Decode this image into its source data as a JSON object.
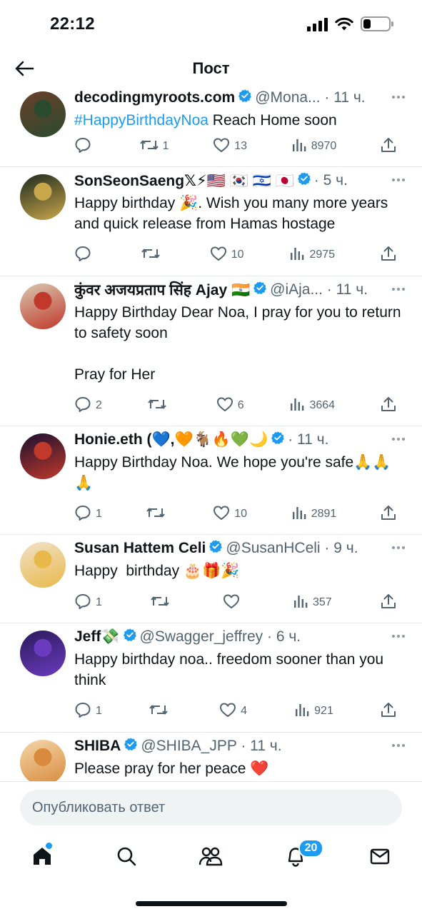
{
  "status_bar": {
    "time": "22:12",
    "battery_level": 0.3
  },
  "header": {
    "title": "Пост"
  },
  "tweets": [
    {
      "name": "decodingmyroots.com",
      "meta": "@Mona... · 11 ч.",
      "hashtag": "#HappyBirthdayNoa",
      "text": " Reach Home soon",
      "reply_count": "",
      "retweet_count": "1",
      "like_count": "13",
      "view_count": "8970",
      "avatar_colors": [
        "#6b3f2a",
        "#2a4b2e"
      ]
    },
    {
      "name": "SonSeonSaeng𝕏⚡🇺🇸 🇰🇷 🇮🇱 🇯🇵",
      "meta": "· 5 ч.",
      "text": "Happy birthday 🎉. Wish you many more years and quick release from Hamas hostage",
      "reply_count": "",
      "retweet_count": "",
      "like_count": "10",
      "view_count": "2975",
      "avatar_colors": [
        "#1d2a1f",
        "#c8a64a"
      ]
    },
    {
      "name": "कुंवर अजयप्रताप सिंह Ajay 🇮🇳",
      "meta": "@iAja... · 11 ч.",
      "text": "Happy Birthday Dear Noa, I pray for you to return to safety soon\n\nPray for Her",
      "reply_count": "2",
      "retweet_count": "",
      "like_count": "6",
      "view_count": "3664",
      "avatar_colors": [
        "#d9c8b0",
        "#c0392b"
      ]
    },
    {
      "name": "Honie.eth (💙,🧡🐐🔥💚🌙",
      "meta": "· 11 ч.",
      "text": "Happy Birthday Noa. We hope you're safe🙏🙏🙏",
      "reply_count": "1",
      "retweet_count": "",
      "like_count": "10",
      "view_count": "2891",
      "avatar_colors": [
        "#1a1030",
        "#c0392b"
      ]
    },
    {
      "name": "Susan Hattem Celi",
      "meta": "@SusanHCeli · 9 ч.",
      "text": "Happy  birthday 🎂🎁🎉",
      "reply_count": "1",
      "retweet_count": "",
      "like_count": "",
      "view_count": "357",
      "avatar_colors": [
        "#f1e2c8",
        "#e8b84a"
      ]
    },
    {
      "name": "Jeff💸",
      "meta": "@Swagger_jeffrey · 6 ч.",
      "text": "Happy birthday noa.. freedom sooner than you think",
      "reply_count": "1",
      "retweet_count": "",
      "like_count": "4",
      "view_count": "921",
      "avatar_colors": [
        "#2b1a5a",
        "#6a3bbf"
      ]
    },
    {
      "name": "SHIBA",
      "meta": "@SHIBA_JPP · 11 ч.",
      "text": "Please pray for her peace ❤️",
      "reply_count": "",
      "retweet_count": "",
      "like_count": "",
      "view_count": "",
      "avatar_colors": [
        "#f3d6a8",
        "#d98a3c"
      ]
    }
  ],
  "reply": {
    "placeholder": "Опубликовать ответ"
  },
  "nav": {
    "notifications_badge": "20"
  },
  "colors": {
    "accent": "#1d9bf0",
    "text": "#0f1419",
    "muted": "#536471",
    "divider": "#e6e9eb"
  },
  "icons": [
    "back-arrow-icon",
    "verified-badge-icon",
    "more-icon",
    "reply-icon",
    "retweet-icon",
    "like-icon",
    "views-icon",
    "share-icon",
    "home-icon",
    "search-icon",
    "communities-icon",
    "notifications-icon",
    "messages-icon"
  ]
}
